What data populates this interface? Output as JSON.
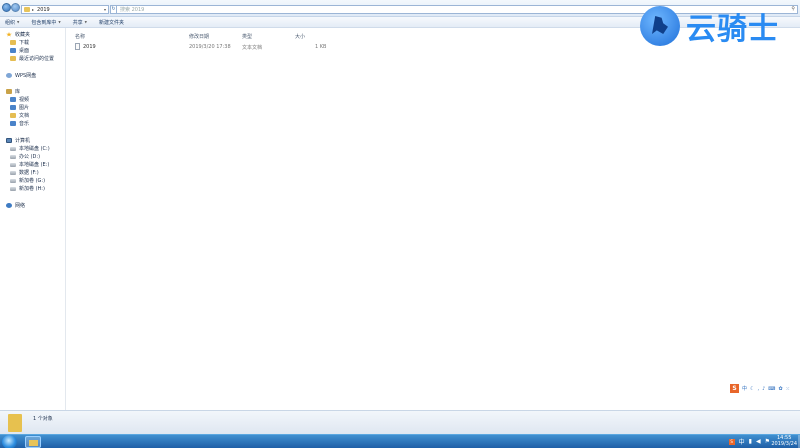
{
  "address_bar": {
    "path_separator": "▸",
    "current_folder": "2019",
    "search_placeholder": "搜索 2019"
  },
  "toolbar": {
    "organize": "组织",
    "include_in_library": "包含到库中",
    "share": "共享",
    "new_folder": "新建文件夹"
  },
  "sidebar": {
    "favorites": "收藏夹",
    "favorites_items": [
      "下载",
      "桌面",
      "最近访问的位置"
    ],
    "wps": "WPS网盘",
    "libraries": "库",
    "library_items": [
      "视频",
      "图片",
      "文档",
      "音乐"
    ],
    "computer": "计算机",
    "drives": [
      "本地磁盘 (C:)",
      "办公 (D:)",
      "本地磁盘 (E:)",
      "数据 (F:)",
      "新加卷 (G:)",
      "新加卷 (H:)"
    ],
    "network": "网络"
  },
  "file_list": {
    "columns": {
      "name": "名称",
      "date_modified": "修改日期",
      "type": "类型",
      "size": "大小"
    },
    "rows": [
      {
        "name": "2019",
        "date": "2019/3/20 17:38",
        "type": "文本文档",
        "size": "1 KB"
      }
    ]
  },
  "watermark": {
    "brand_text": "云骑士"
  },
  "ime_bar": {
    "mode_label": "中"
  },
  "status": {
    "item_count": "1 个对象"
  },
  "taskbar": {
    "tray_ime": "S",
    "tray_lang": "中",
    "time": "14:55",
    "date": "2019/3/24"
  },
  "colors": {
    "accent": "#2a8bf2",
    "taskbar": "#1f5fa6",
    "folder": "#e7c14f"
  }
}
